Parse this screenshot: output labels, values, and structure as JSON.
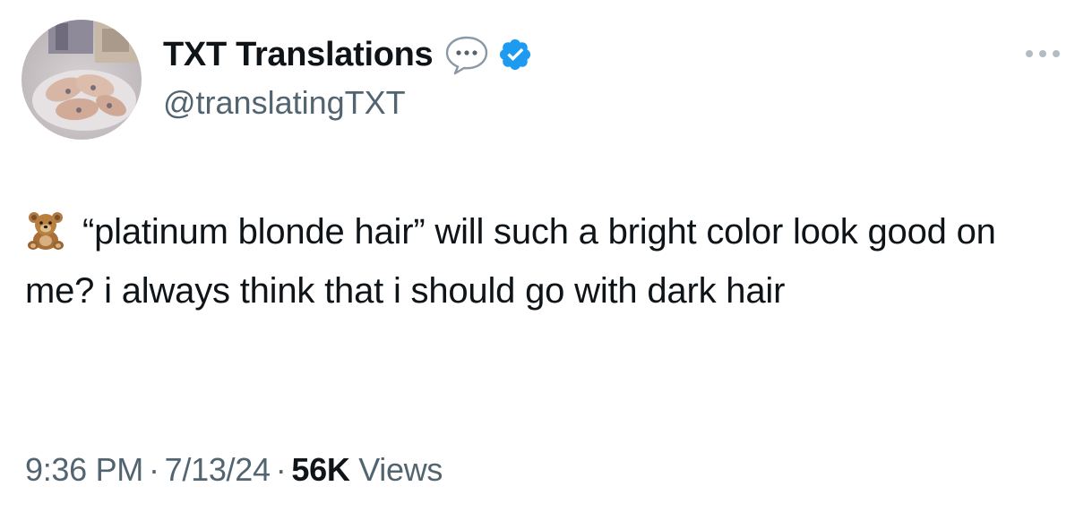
{
  "author": {
    "display_name": "TXT Translations",
    "handle": "@translatingTXT",
    "verified": true
  },
  "icons": {
    "speech_bubble": "speech-bubble-icon",
    "verified_badge": "verified-badge-icon",
    "more": "more-options-icon",
    "emoji": "teddy-bear-emoji-icon"
  },
  "tweet": {
    "text": "“platinum blonde hair” will such a bright color look good on me? i always think that i should go with dark hair"
  },
  "meta": {
    "time": "9:36 PM",
    "separator": "·",
    "date": "7/13/24",
    "views_count": "56K",
    "views_label": "Views"
  },
  "colors": {
    "text_primary": "#0f1419",
    "text_secondary": "#536471",
    "verified_blue": "#1d9bf0",
    "more_icon": "#b3bcc4"
  }
}
